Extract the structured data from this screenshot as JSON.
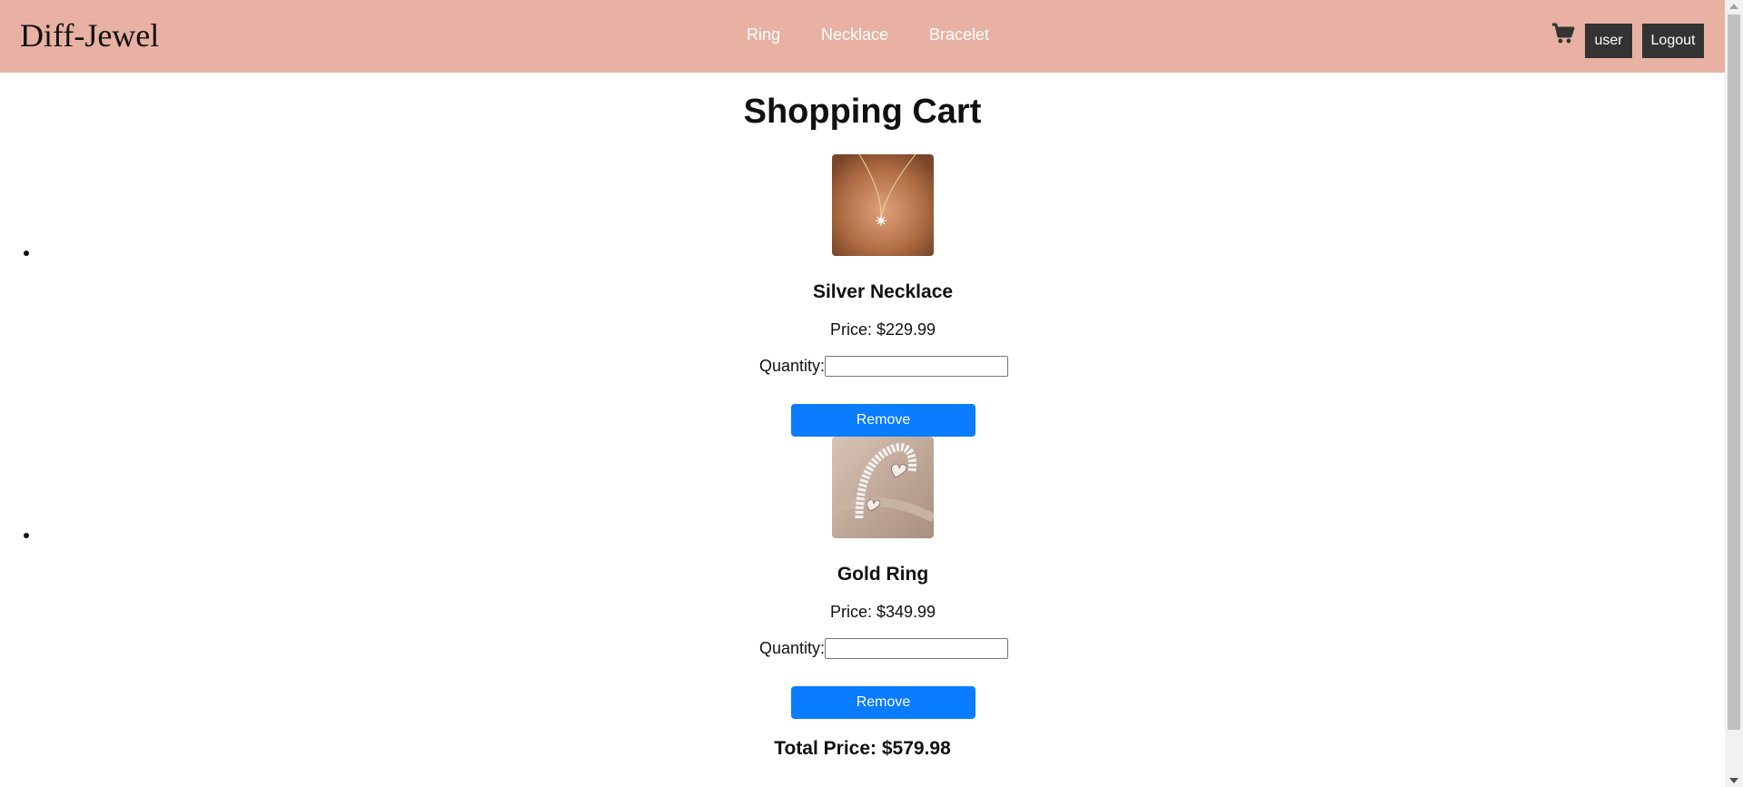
{
  "header": {
    "brand": "Diff-Jewel",
    "nav": [
      "Ring",
      "Necklace",
      "Bracelet"
    ],
    "user_label": "user",
    "logout_label": "Logout"
  },
  "main": {
    "title": "Shopping Cart",
    "items": [
      {
        "name": "Silver Necklace",
        "price_text": "Price: $229.99",
        "quantity_label": "Quantity:",
        "quantity_value": "",
        "remove_label": "Remove"
      },
      {
        "name": "Gold Ring",
        "price_text": "Price: $349.99",
        "quantity_label": "Quantity:",
        "quantity_value": "",
        "remove_label": "Remove"
      }
    ],
    "total_text": "Total Price: $579.98"
  },
  "colors": {
    "header_bg": "#e8b1a3",
    "button_dark": "#333333",
    "remove_blue": "#0a7cff"
  }
}
